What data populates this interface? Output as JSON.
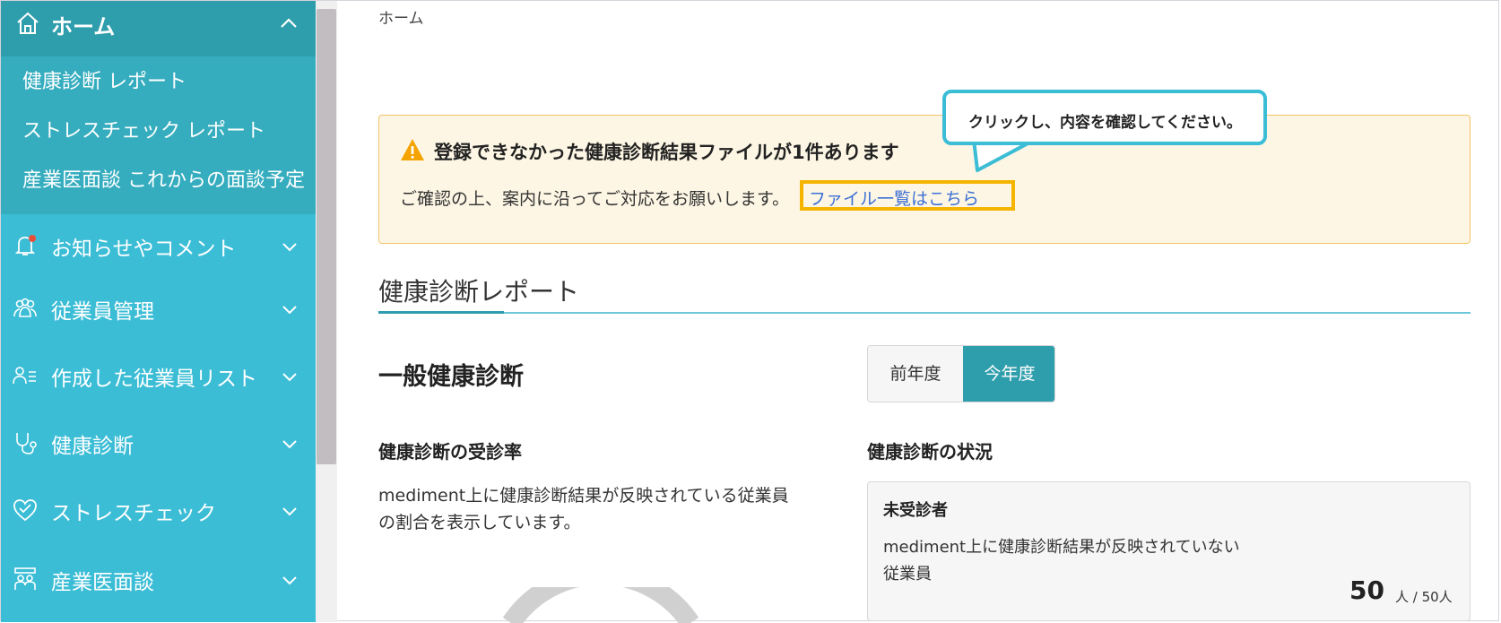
{
  "sidebar": {
    "home": {
      "label": "ホーム",
      "icon": "home-icon"
    },
    "sub_items": [
      "健康診断 レポート",
      "ストレスチェック レポート",
      "産業医面談 これからの面談予定"
    ],
    "items": [
      {
        "label": "お知らせやコメント",
        "icon": "bell-icon"
      },
      {
        "label": "従業員管理",
        "icon": "people-icon"
      },
      {
        "label": "作成した従業員リスト",
        "icon": "person-list-icon"
      },
      {
        "label": "健康診断",
        "icon": "stethoscope-icon"
      },
      {
        "label": "ストレスチェック",
        "icon": "heart-icon"
      },
      {
        "label": "産業医面談",
        "icon": "meeting-icon"
      }
    ]
  },
  "breadcrumb": "ホーム",
  "alert": {
    "title": "登録できなかった健康診断結果ファイルが1件あります",
    "body": "ご確認の上、案内に沿ってご対応をお願いします。",
    "link": "ファイル一覧はこちら"
  },
  "callout": "クリックし、内容を確認してください。",
  "section": {
    "title": "健康診断レポート"
  },
  "subsection": {
    "title": "一般健康診断"
  },
  "toggle": {
    "prev": "前年度",
    "current": "今年度"
  },
  "rate": {
    "title": "健康診断の受診率",
    "desc_line1": "mediment上に健康診断結果が反映されている従業員",
    "desc_line2": "の割合を表示しています。"
  },
  "status": {
    "title": "健康診断の状況",
    "card_title": "未受診者",
    "desc_line1": "mediment上に健康診断結果が反映されていない",
    "desc_line2": "従業員",
    "count": "50",
    "unit": "人 / 50人"
  },
  "colors": {
    "sidebar_bg": "#3bbdd6",
    "sidebar_active": "#2f9eac",
    "sidebar_sub": "#36adbf",
    "alert_bg": "#fdf6e4",
    "alert_border": "#f3c36a",
    "link": "#3b6fd6",
    "highlight": "#f5b400"
  }
}
